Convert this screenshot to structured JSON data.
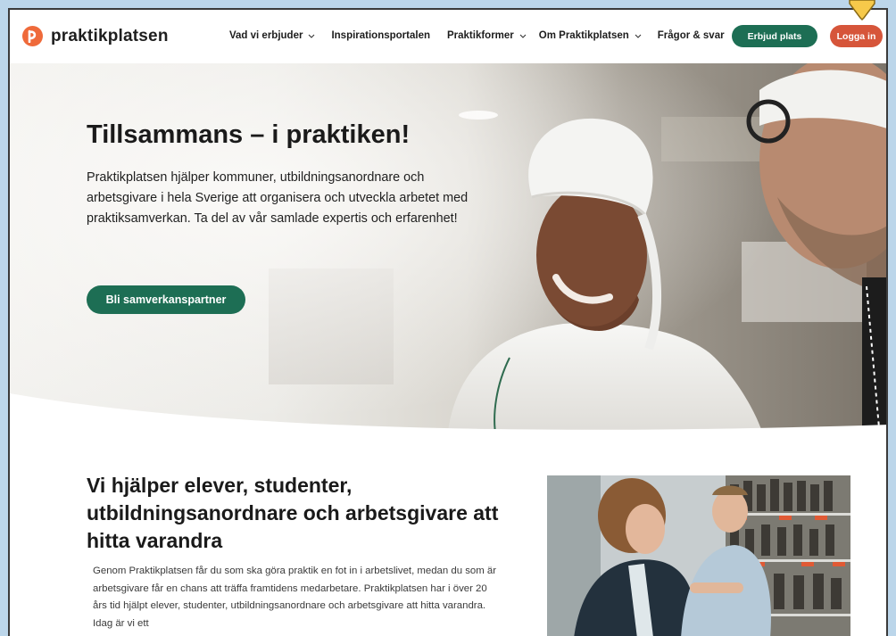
{
  "brand": {
    "name": "praktikplatsen",
    "logo_color": "#ef6a3a"
  },
  "nav": {
    "items": [
      {
        "label": "Vad vi erbjuder",
        "has_dropdown": true,
        "icon": "chevron-down-icon"
      },
      {
        "label": "Inspirationsportalen",
        "has_dropdown": false
      },
      {
        "label": "Praktikformer",
        "has_dropdown": true,
        "icon": "chevron-down-icon"
      },
      {
        "label": "Om Praktikplatsen",
        "has_dropdown": true,
        "icon": "chevron-down-icon"
      },
      {
        "label": "Frågor & svar",
        "has_dropdown": false
      }
    ],
    "offer_button": "Erbjud plats",
    "login_button": "Logga in"
  },
  "hero": {
    "title": "Tillsammans – i praktiken!",
    "text": "Praktikplatsen hjälper kommuner, utbildningsanordnare och arbetsgivare i hela Sverige att organisera och utveckla arbetet med praktiksamverkan. Ta del av vår samlade expertis och erfarenhet!",
    "cta": "Bli samverkanspartner"
  },
  "section": {
    "title": "Vi hjälper elever, studenter, utbildningsanordnare och arbetsgivare att hitta varandra",
    "text": "Genom Praktikplatsen får du som ska göra praktik en fot in i arbetslivet, medan du som är arbetsgivare får en chans att träffa framtidens medarbetare. Praktikplatsen har i över 20 års tid hjälpt elever, studenter, utbildningsanordnare och arbetsgivare att hitta varandra. Idag är vi ett"
  },
  "colors": {
    "primary_green": "#1d6e54",
    "login_red": "#d6553a",
    "cursor_yellow": "#f6c94a"
  }
}
